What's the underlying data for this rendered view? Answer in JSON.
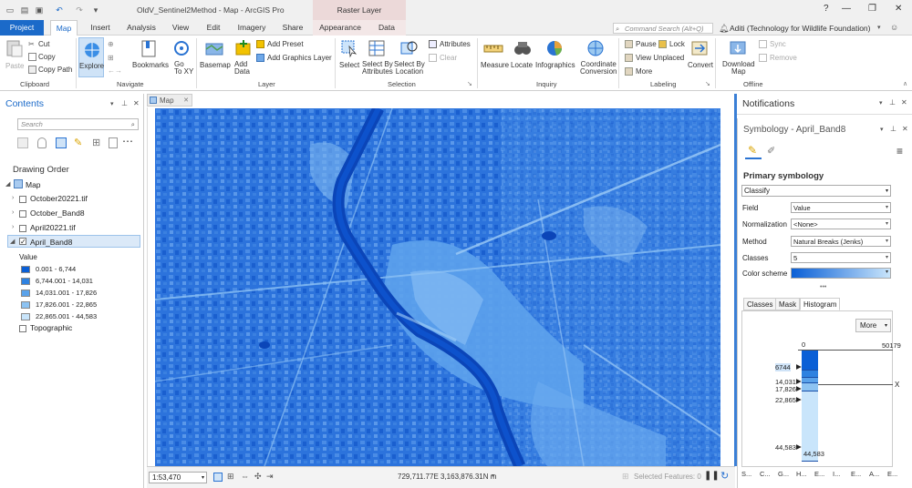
{
  "titlebar": {
    "title": "OldV_Sentinel2Method - Map - ArcGIS Pro",
    "context_tab": "Raster Layer",
    "help": "?",
    "minimize": "—",
    "restore": "❐",
    "close": "✕"
  },
  "tabs": {
    "project": "Project",
    "map": "Map",
    "insert": "Insert",
    "analysis": "Analysis",
    "view": "View",
    "edit": "Edit",
    "imagery": "Imagery",
    "share": "Share",
    "appearance": "Appearance",
    "data": "Data"
  },
  "command_search": {
    "placeholder": "Command Search (Alt+Q)"
  },
  "user": {
    "name": "Aditi (Technology for Wildlife Foundation)"
  },
  "ribbon": {
    "clipboard": {
      "paste": "Paste",
      "cut": "Cut",
      "copy": "Copy",
      "copy_path": "Copy Path",
      "group": "Clipboard"
    },
    "navigate": {
      "explore": "Explore",
      "bookmarks": "Bookmarks",
      "go_to_xy": "Go\nTo XY",
      "group": "Navigate"
    },
    "layer": {
      "basemap": "Basemap",
      "add_data": "Add\nData",
      "add_preset": "Add Preset",
      "add_graphics_layer": "Add Graphics Layer",
      "group": "Layer"
    },
    "selection": {
      "select": "Select",
      "select_by_attributes": "Select By\nAttributes",
      "select_by_location": "Select By\nLocation",
      "attributes": "Attributes",
      "clear": "Clear",
      "group": "Selection"
    },
    "inquiry": {
      "measure": "Measure",
      "locate": "Locate",
      "infographics": "Infographics",
      "coordinate_conversion": "Coordinate\nConversion",
      "group": "Inquiry"
    },
    "labeling": {
      "pause": "Pause",
      "lock": "Lock",
      "view_unplaced": "View Unplaced",
      "more": "More",
      "convert": "Convert",
      "group": "Labeling"
    },
    "offline": {
      "download_map": "Download\nMap",
      "sync": "Sync",
      "remove": "Remove",
      "group": "Offline"
    }
  },
  "contents": {
    "title": "Contents",
    "search_placeholder": "Search",
    "drawing_order": "Drawing Order",
    "map_name": "Map",
    "layers": [
      "October20221.tif",
      "October_Band8",
      "April20221.tif",
      "April_Band8"
    ],
    "value_label": "Value",
    "legend": [
      {
        "label": "0.001 - 6,744",
        "color": "#0a5fd6"
      },
      {
        "label": "6,744.001 - 14,031",
        "color": "#2f82e0"
      },
      {
        "label": "14,031.001 - 17,826",
        "color": "#5aa2ea"
      },
      {
        "label": "17,826.001 - 22,865",
        "color": "#8dc3f2"
      },
      {
        "label": "22,865.001 - 44,583",
        "color": "#c9e5fb"
      }
    ],
    "topographic": "Topographic"
  },
  "map": {
    "tab": "Map",
    "scale": "1:53,470",
    "coordinates": "729,711.77E 3,163,876.31N m",
    "selected_features": "Selected Features: 0"
  },
  "notifications": {
    "title": "Notifications"
  },
  "symbology": {
    "title": "Symbology - April_Band8",
    "primary": "Primary symbology",
    "renderer": "Classify",
    "field_label": "Field",
    "field_value": "Value",
    "normalization_label": "Normalization",
    "normalization_value": "<None>",
    "method_label": "Method",
    "method_value": "Natural Breaks (Jenks)",
    "classes_label": "Classes",
    "classes_value": "5",
    "color_scheme_label": "Color scheme",
    "tabs": [
      "Classes",
      "Mask",
      "Histogram"
    ],
    "more_button": "More",
    "hist_min": "0",
    "hist_max": "50179",
    "breaks": [
      "6744",
      "14,031",
      "17,826",
      "22,865",
      "44,583"
    ],
    "hist_bottom": "44,583",
    "axis_x": "X",
    "bottom_tabs": [
      "S...",
      "C...",
      "G...",
      "H...",
      "E...",
      "I...",
      "E...",
      "A...",
      "E..."
    ]
  }
}
